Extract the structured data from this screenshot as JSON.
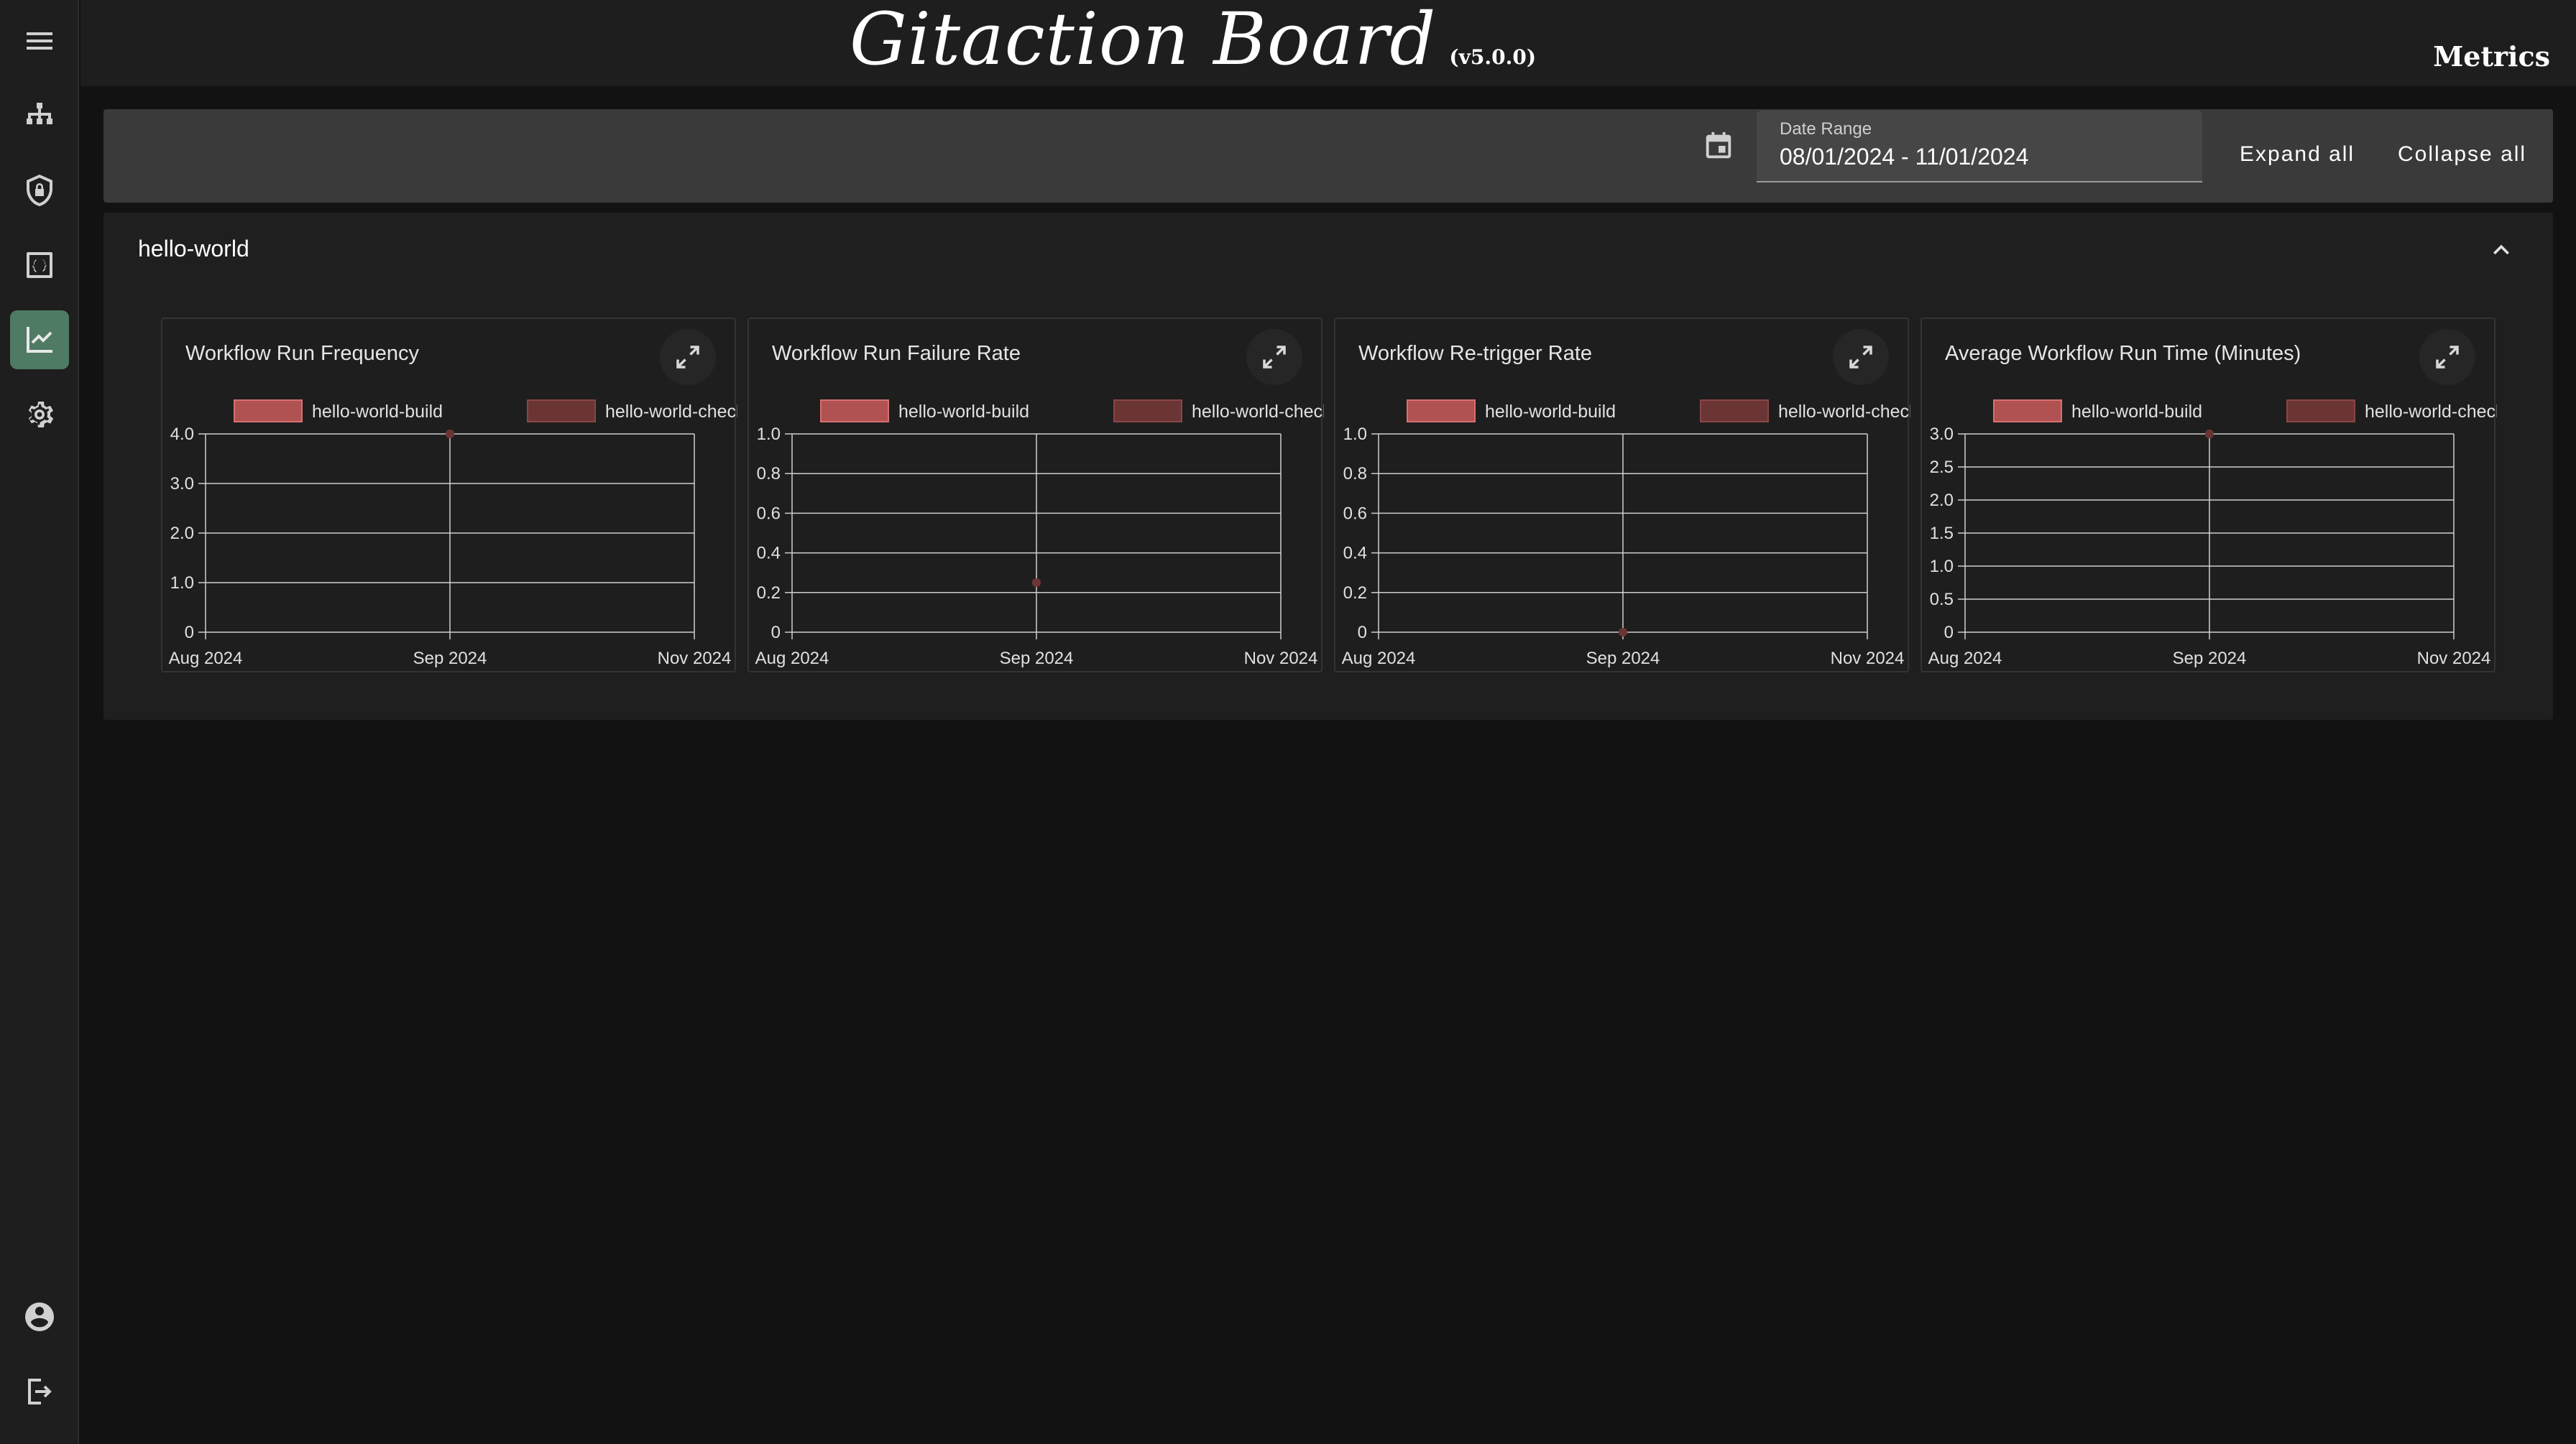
{
  "header": {
    "brand_name": "Gitaction Board",
    "version": "(v5.0.0)",
    "page_label": "Metrics"
  },
  "sidebar": {
    "items": [
      {
        "icon": "menu-icon"
      },
      {
        "icon": "sitemap-icon"
      },
      {
        "icon": "shield-lock-icon"
      },
      {
        "icon": "code-braces-icon"
      },
      {
        "icon": "chart-line-icon",
        "active": true
      },
      {
        "icon": "gear-icon"
      },
      {
        "icon": "account-circle-icon"
      },
      {
        "icon": "logout-icon"
      }
    ]
  },
  "toolbar": {
    "date_label": "Date Range",
    "date_value": "08/01/2024 - 11/01/2024",
    "expand_label": "Expand all",
    "collapse_label": "Collapse all"
  },
  "section": {
    "title": "hello-world"
  },
  "colors": {
    "series_build": "#b05252",
    "series_checks": "#6b3535",
    "active_nav": "#4f7a64"
  },
  "chart_data": [
    {
      "type": "line",
      "title": "Workflow Run Frequency",
      "x_ticks": [
        "Aug 2024",
        "Sep 2024",
        "Nov 2024"
      ],
      "y_ticks": [
        "0",
        "1.0",
        "2.0",
        "3.0",
        "4.0"
      ],
      "ylim": [
        0,
        4
      ],
      "grid": true,
      "legend": "top-center",
      "series": [
        {
          "name": "hello-world-build",
          "points": [
            {
              "x": "Sep 2024",
              "y": 4
            }
          ]
        },
        {
          "name": "hello-world-checks",
          "points": [
            {
              "x": "Sep 2024",
              "y": 4
            }
          ]
        }
      ]
    },
    {
      "type": "line",
      "title": "Workflow Run Failure Rate",
      "x_ticks": [
        "Aug 2024",
        "Sep 2024",
        "Nov 2024"
      ],
      "y_ticks": [
        "0",
        "0.2",
        "0.4",
        "0.6",
        "0.8",
        "1.0"
      ],
      "ylim": [
        0,
        1
      ],
      "grid": true,
      "legend": "top-center",
      "series": [
        {
          "name": "hello-world-build",
          "points": [
            {
              "x": "Sep 2024",
              "y": 0.25
            }
          ]
        },
        {
          "name": "hello-world-checks",
          "points": [
            {
              "x": "Sep 2024",
              "y": 0.25
            }
          ]
        }
      ]
    },
    {
      "type": "line",
      "title": "Workflow Re-trigger Rate",
      "x_ticks": [
        "Aug 2024",
        "Sep 2024",
        "Nov 2024"
      ],
      "y_ticks": [
        "0",
        "0.2",
        "0.4",
        "0.6",
        "0.8",
        "1.0"
      ],
      "ylim": [
        0,
        1
      ],
      "grid": true,
      "legend": "top-center",
      "series": [
        {
          "name": "hello-world-build",
          "points": [
            {
              "x": "Sep 2024",
              "y": 0
            }
          ]
        },
        {
          "name": "hello-world-checks",
          "points": [
            {
              "x": "Sep 2024",
              "y": 0
            }
          ]
        }
      ]
    },
    {
      "type": "line",
      "title": "Average Workflow Run Time (Minutes)",
      "x_ticks": [
        "Aug 2024",
        "Sep 2024",
        "Nov 2024"
      ],
      "y_ticks": [
        "0",
        "0.5",
        "1.0",
        "1.5",
        "2.0",
        "2.5",
        "3.0"
      ],
      "ylim": [
        0,
        3
      ],
      "grid": true,
      "legend": "top-center",
      "series": [
        {
          "name": "hello-world-build",
          "points": [
            {
              "x": "Sep 2024",
              "y": 3
            }
          ]
        },
        {
          "name": "hello-world-checks",
          "points": [
            {
              "x": "Sep 2024",
              "y": 3
            }
          ]
        }
      ]
    }
  ]
}
